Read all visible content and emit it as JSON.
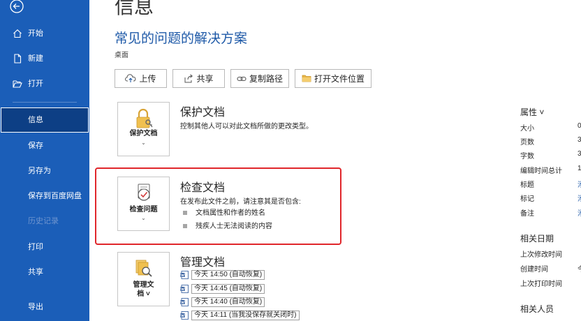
{
  "sidebar": {
    "items": [
      {
        "label": "开始",
        "icon": "home-icon"
      },
      {
        "label": "新建",
        "icon": "new-document-icon"
      },
      {
        "label": "打开",
        "icon": "folder-open-icon"
      },
      {
        "label": "信息"
      },
      {
        "label": "保存"
      },
      {
        "label": "另存为"
      },
      {
        "label": "保存到百度网盘"
      },
      {
        "label": "历史记录"
      },
      {
        "label": "打印"
      },
      {
        "label": "共享"
      },
      {
        "label": "导出"
      }
    ],
    "active": "信息",
    "disabled": "历史记录"
  },
  "main": {
    "page_title": "信息",
    "doc_title": "常见的问题的解决方案",
    "doc_location": "桌面",
    "toolbar": {
      "upload_label": "上传",
      "share_label": "共享",
      "copy_path_label": "复制路径",
      "open_location_label": "打开文件位置"
    },
    "protect": {
      "button_label": "保护文档",
      "title": "保护文档",
      "description": "控制其他人可以对此文档所做的更改类型。"
    },
    "inspect": {
      "button_label": "检查问题",
      "title": "检查文档",
      "description": "在发布此文件之前，请注意其是否包含:",
      "bullets": [
        "文档属性和作者的姓名",
        "残疾人士无法阅读的内容"
      ]
    },
    "manage": {
      "button_label_line1": "管理文",
      "button_label_line2": "档",
      "title": "管理文档",
      "versions": [
        "今天 14:50 (自动恢复)",
        "今天 14:45 (自动恢复)",
        "今天 14:40 (自动恢复)",
        "今天 14:11 (当我没保存就关闭时)"
      ]
    }
  },
  "properties": {
    "heading": "属性 ˅",
    "rows": [
      {
        "label": "大小",
        "value": "0"
      },
      {
        "label": "页数",
        "value": "3"
      },
      {
        "label": "字数",
        "value": "3"
      },
      {
        "label": "编辑时间总计",
        "value": "1"
      },
      {
        "label": "标题",
        "value": "添"
      },
      {
        "label": "标记",
        "value": "添"
      },
      {
        "label": "备注",
        "value": "添"
      }
    ],
    "dates_heading": "相关日期",
    "dates": [
      {
        "label": "上次修改时间",
        "value": ""
      },
      {
        "label": "创建时间",
        "value": "今"
      },
      {
        "label": "上次打印时间",
        "value": ""
      }
    ],
    "people_heading": "相关人员"
  },
  "colors": {
    "sidebar_bg": "#1b5eb8",
    "active_item_bg": "#0d3f85",
    "doc_title": "#1f5aa8",
    "highlight_border": "#e0262b"
  }
}
